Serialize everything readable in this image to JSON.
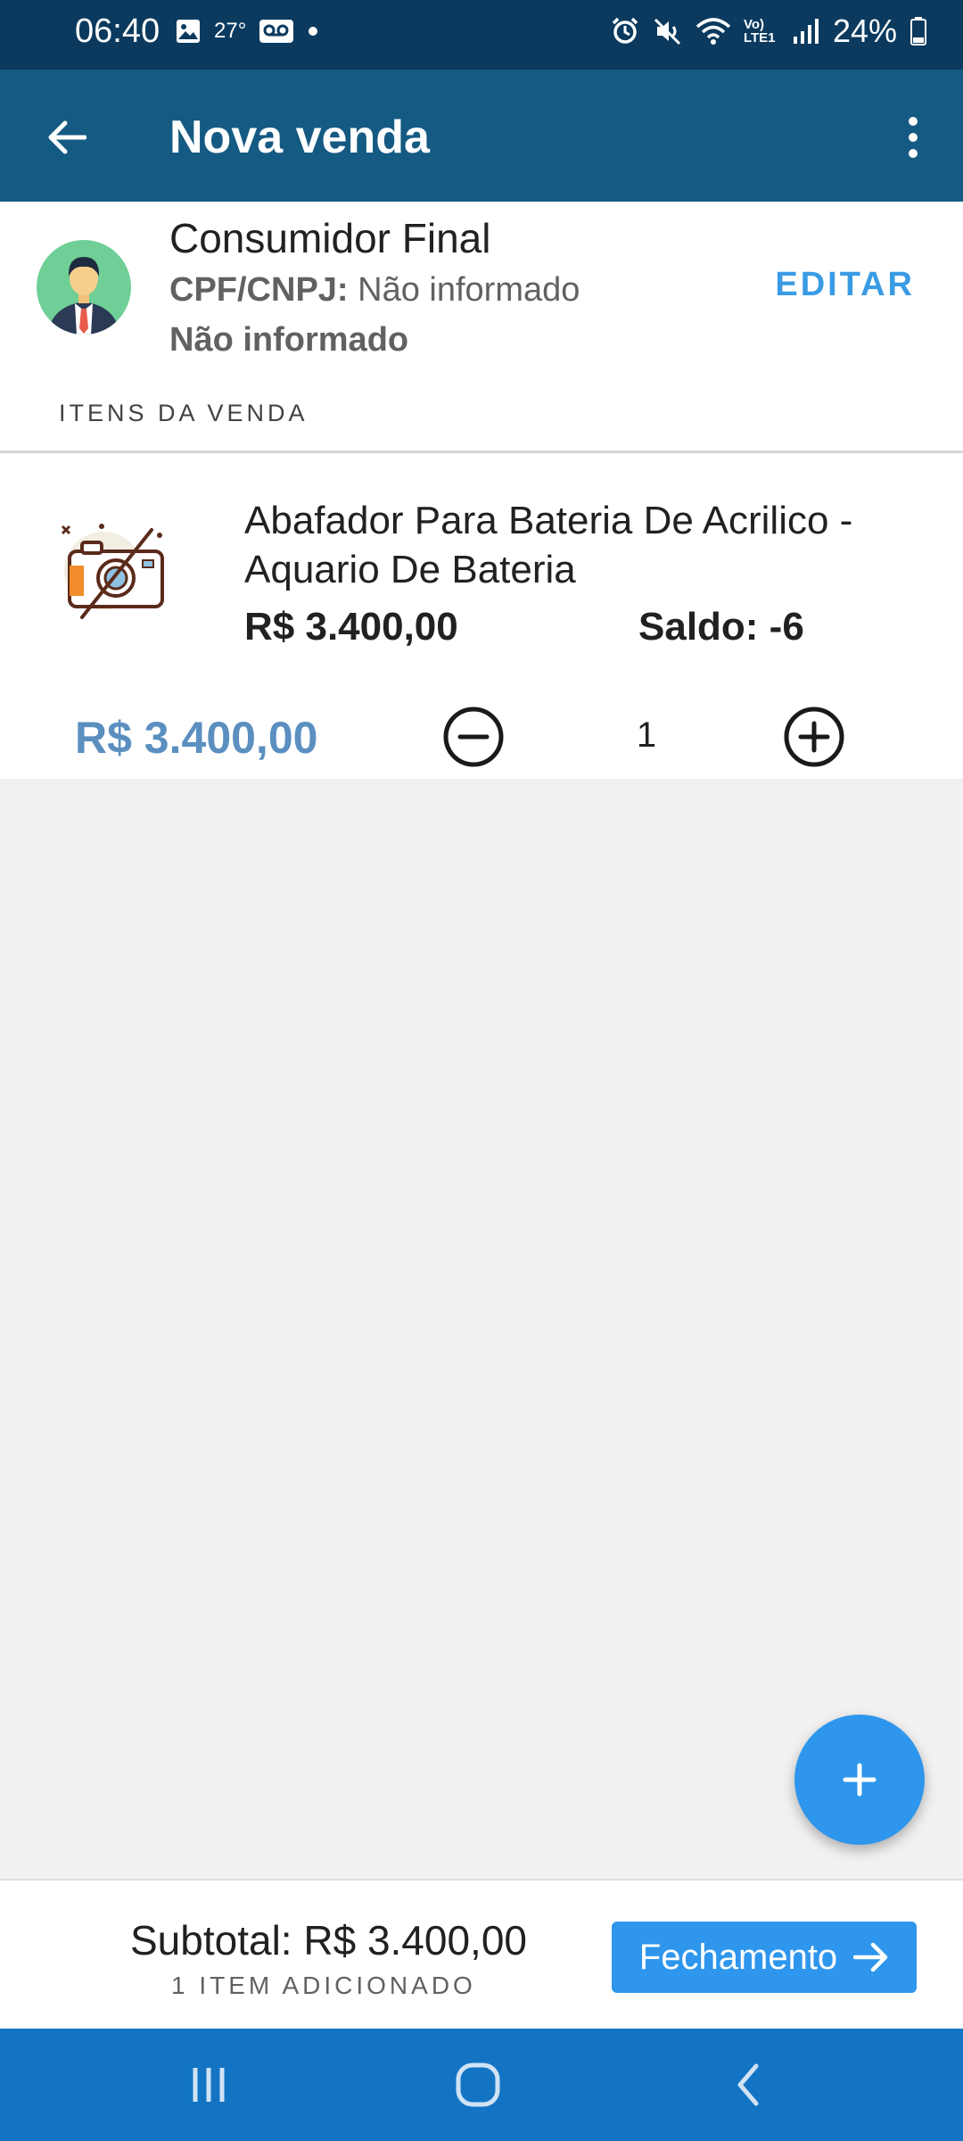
{
  "status_bar": {
    "time": "06:40",
    "temperature": "27°",
    "battery": "24%",
    "network": "Vo) LTE1"
  },
  "app_bar": {
    "title": "Nova venda"
  },
  "customer": {
    "name": "Consumidor Final",
    "doc_label": "CPF/CNPJ:",
    "doc_value": "Não informado",
    "secondary": "Não informado",
    "edit_label": "EDITAR"
  },
  "section_label": "ITENS DA VENDA",
  "item": {
    "name": "Abafador Para Bateria De Acrilico - Aquario De Bateria",
    "unit_price": "R$ 3.400,00",
    "stock": "Saldo: -6",
    "total": "R$ 3.400,00",
    "quantity": "1"
  },
  "footer": {
    "subtotal": "Subtotal: R$ 3.400,00",
    "items_count": "1 ITEM ADICIONADO",
    "close_label": "Fechamento"
  },
  "colors": {
    "status_bar": "#0b3a5e",
    "app_bar": "#155a82",
    "accent": "#2e96ec",
    "link": "#3a9be5",
    "total_price": "#5b8fc0",
    "nav_bar": "#1474c4"
  },
  "icons": {
    "back": "arrow-left-icon",
    "more": "more-vert-icon",
    "avatar": "user-avatar-icon",
    "thumb": "no-photo-icon",
    "minus": "minus-circle-icon",
    "plus": "plus-circle-icon",
    "fab": "add-icon",
    "next": "arrow-right-icon"
  }
}
